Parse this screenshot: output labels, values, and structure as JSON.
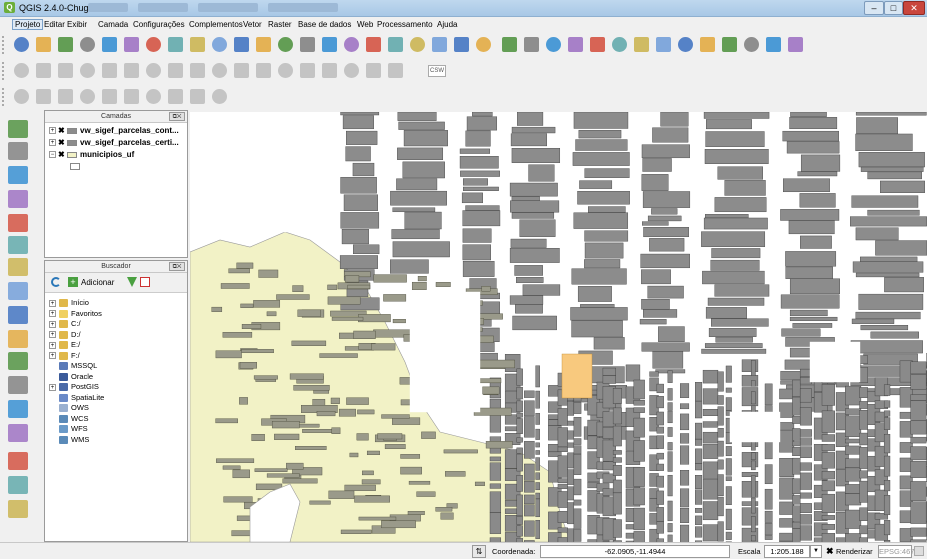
{
  "window": {
    "title": "QGIS 2.4.0-Chugiak",
    "logo_letter": "Q",
    "minimize": "–",
    "maximize": "□",
    "close": "✕"
  },
  "menu": [
    "Projeto",
    "Editar",
    "Exibir",
    "Camada",
    "Configurações",
    "Complementos",
    "Vetor",
    "Raster",
    "Base de dados",
    "Web",
    "Processamento",
    "Ajuda"
  ],
  "layers_panel": {
    "title": "Camadas",
    "items": [
      {
        "name": "vw_sigef_parcelas_cont...",
        "expand": "+",
        "checked": "✖"
      },
      {
        "name": "vw_sigef_parcelas_certi...",
        "expand": "+",
        "checked": "✖"
      },
      {
        "name": "municipios_uf",
        "expand": "−",
        "checked": "✖"
      }
    ]
  },
  "browser_panel": {
    "title": "Buscador",
    "add_label": "Adicionar",
    "items": [
      {
        "label": "Início",
        "expand": "+"
      },
      {
        "label": "Favoritos",
        "expand": "+"
      },
      {
        "label": "C:/",
        "expand": "+"
      },
      {
        "label": "D:/",
        "expand": "+"
      },
      {
        "label": "E:/",
        "expand": "+"
      },
      {
        "label": "F:/",
        "expand": "+"
      },
      {
        "label": "MSSQL",
        "expand": ""
      },
      {
        "label": "Oracle",
        "expand": ""
      },
      {
        "label": "PostGIS",
        "expand": "+"
      },
      {
        "label": "SpatiaLite",
        "expand": ""
      },
      {
        "label": "OWS",
        "expand": ""
      },
      {
        "label": "WCS",
        "expand": ""
      },
      {
        "label": "WFS",
        "expand": ""
      },
      {
        "label": "WMS",
        "expand": ""
      }
    ]
  },
  "statusbar": {
    "coord_label": "Coordenada:",
    "coord_value": "-62.0905,-11.4944",
    "scale_label": "Escala",
    "scale_value": "1:205.188",
    "render_label": "Renderizar",
    "crs": "EPSG:4674"
  },
  "toolbar3_label": "CSW",
  "colors": {
    "parcel": "#8c8c8c",
    "municipio": "#f2f2c6",
    "selected": "#f8c97e",
    "window_frame": "#b4d0ec"
  }
}
